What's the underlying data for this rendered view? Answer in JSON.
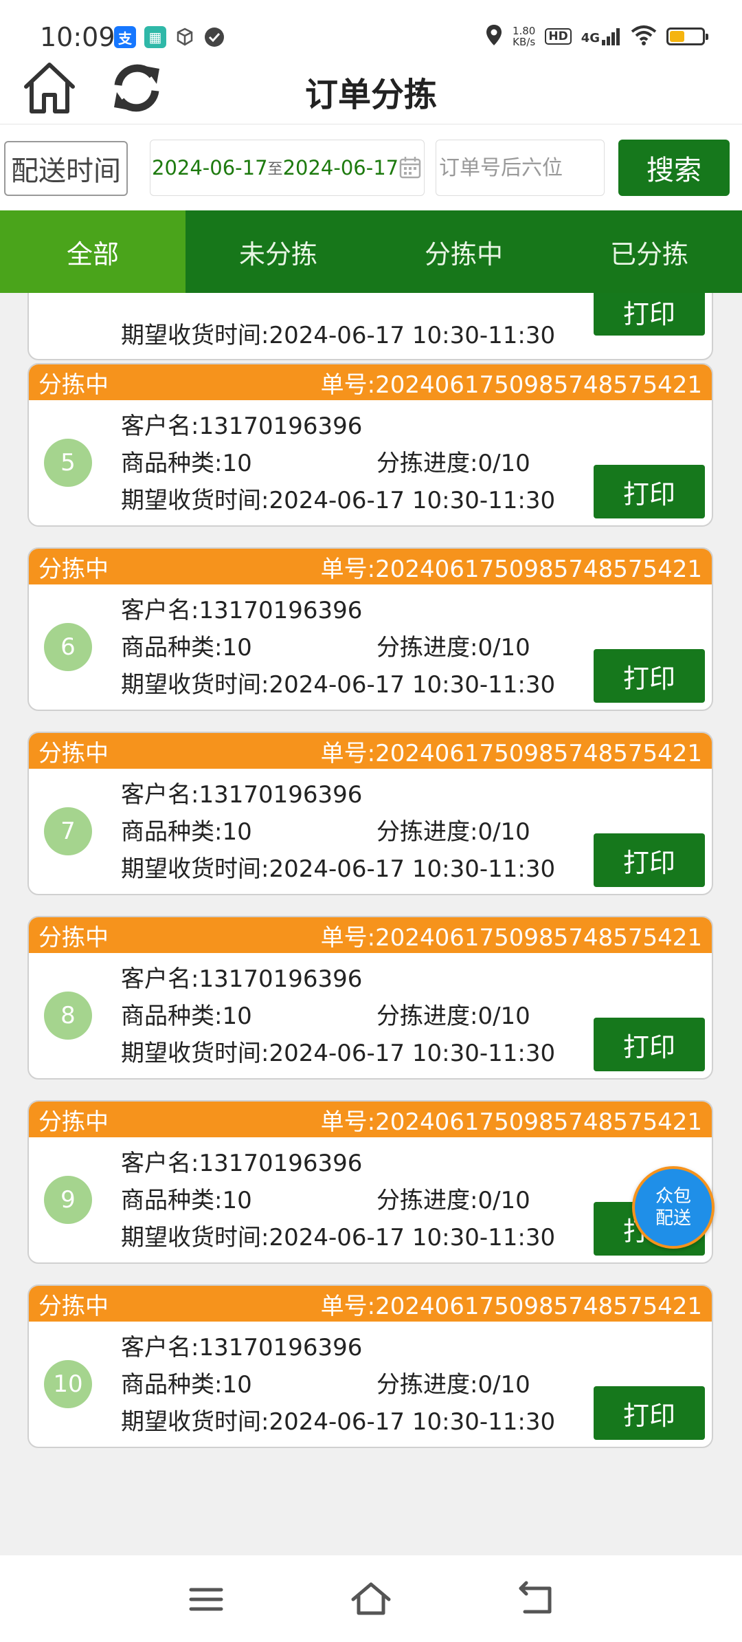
{
  "status_bar": {
    "time": "10:09",
    "net_speed_value": "1.80",
    "net_speed_unit": "KB/s",
    "hd": "HD",
    "network": "4G",
    "battery_level": 0.45,
    "battery_color": "#f5b40f"
  },
  "header": {
    "title": "订单分拣"
  },
  "search": {
    "date_type": "配送时间",
    "date_start": "2024-06-17",
    "date_sep": "至",
    "date_end": "2024-06-17",
    "order_placeholder": "订单号后六位",
    "search_label": "搜索"
  },
  "tabs": [
    {
      "label": "全部",
      "active": true
    },
    {
      "label": "未分拣",
      "active": false
    },
    {
      "label": "分拣中",
      "active": false
    },
    {
      "label": "已分拣",
      "active": false
    }
  ],
  "partial_card": {
    "expected_time": "期望收货时间:2024-06-17 10:30-11:30",
    "print_label": "打印"
  },
  "orders": [
    {
      "index": "5",
      "status": "分拣中",
      "order_no": "单号:2024061750985748575421",
      "customer": "客户名:13170196396",
      "category": "商品种类:10",
      "progress": "分拣进度:0/10",
      "expected_time": "期望收货时间:2024-06-17 10:30-11:30",
      "print_label": "打印"
    },
    {
      "index": "6",
      "status": "分拣中",
      "order_no": "单号:2024061750985748575421",
      "customer": "客户名:13170196396",
      "category": "商品种类:10",
      "progress": "分拣进度:0/10",
      "expected_time": "期望收货时间:2024-06-17 10:30-11:30",
      "print_label": "打印"
    },
    {
      "index": "7",
      "status": "分拣中",
      "order_no": "单号:2024061750985748575421",
      "customer": "客户名:13170196396",
      "category": "商品种类:10",
      "progress": "分拣进度:0/10",
      "expected_time": "期望收货时间:2024-06-17 10:30-11:30",
      "print_label": "打印"
    },
    {
      "index": "8",
      "status": "分拣中",
      "order_no": "单号:2024061750985748575421",
      "customer": "客户名:13170196396",
      "category": "商品种类:10",
      "progress": "分拣进度:0/10",
      "expected_time": "期望收货时间:2024-06-17 10:30-11:30",
      "print_label": "打印"
    },
    {
      "index": "9",
      "status": "分拣中",
      "order_no": "单号:2024061750985748575421",
      "customer": "客户名:13170196396",
      "category": "商品种类:10",
      "progress": "分拣进度:0/10",
      "expected_time": "期望收货时间:2024-06-17 10:30-11:30",
      "print_label": "打印"
    },
    {
      "index": "10",
      "status": "分拣中",
      "order_no": "单号:2024061750985748575421",
      "customer": "客户名:13170196396",
      "category": "商品种类:10",
      "progress": "分拣进度:0/10",
      "expected_time": "期望收货时间:2024-06-17 10:30-11:30",
      "print_label": "打印"
    }
  ],
  "float_button": {
    "line1": "众包",
    "line2": "配送"
  },
  "colors": {
    "primary_green": "#16781c",
    "tab_active": "#4aa41b",
    "order_header": "#f6931c",
    "badge": "#a5d48e",
    "float_blue": "#1f8fe8"
  },
  "icons": {
    "home": "home-icon",
    "refresh": "refresh-icon",
    "calendar": "calendar-icon",
    "nav_menu": "menu-icon",
    "nav_home": "nav-home-icon",
    "nav_back": "back-icon"
  }
}
